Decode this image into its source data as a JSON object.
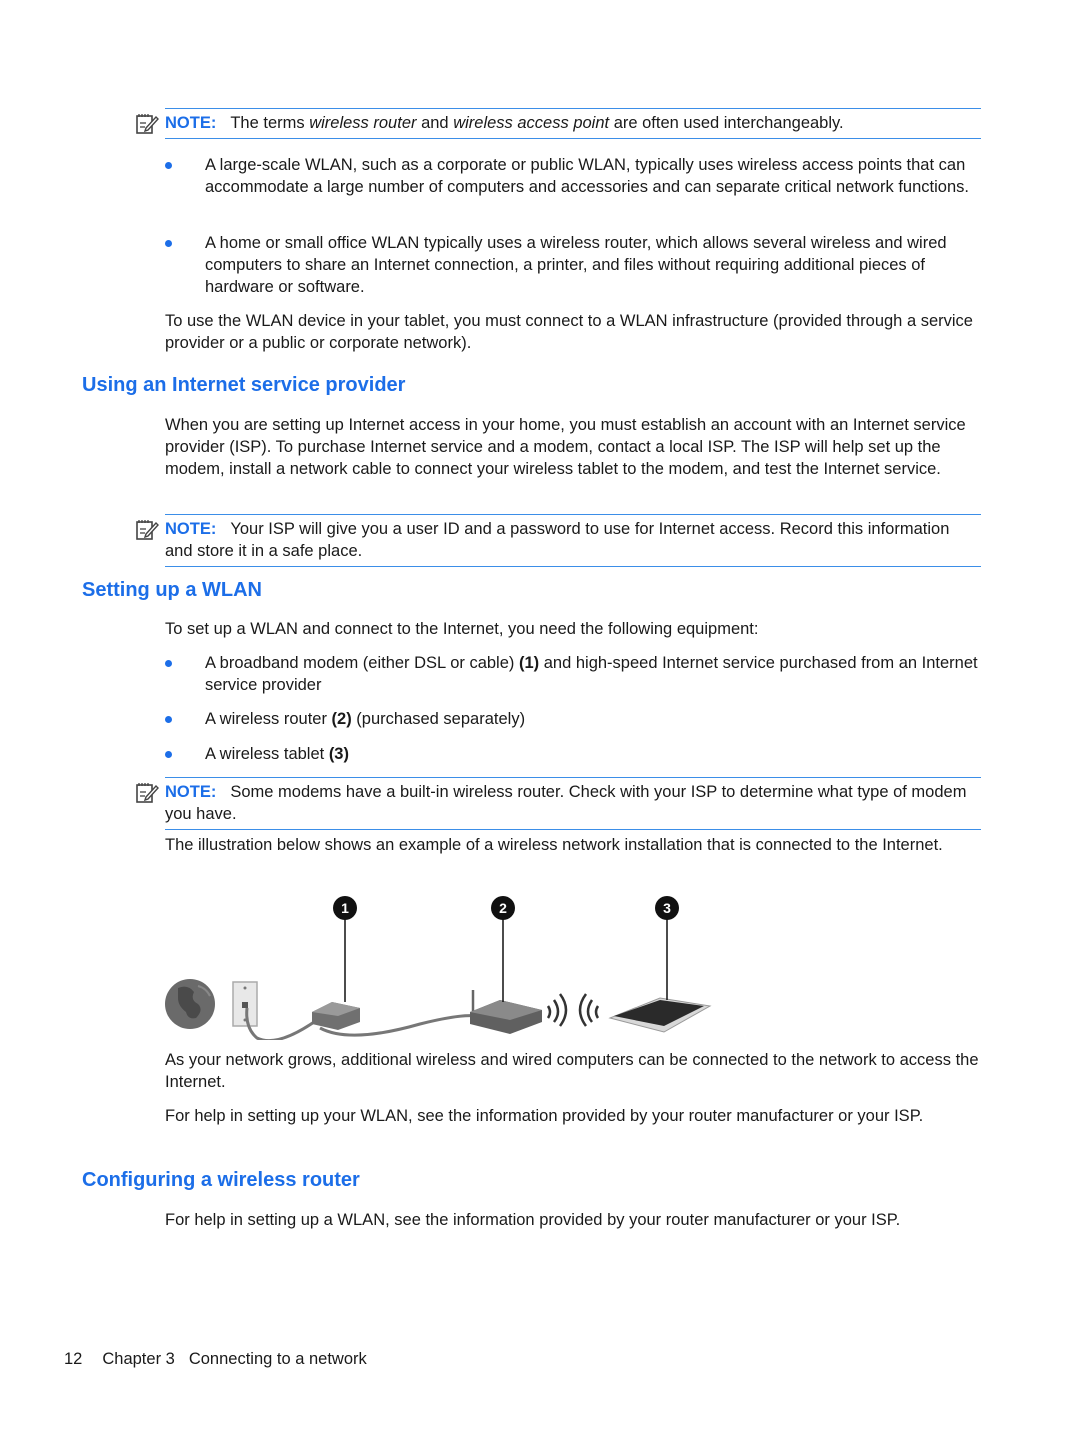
{
  "note1": {
    "label": "NOTE:",
    "text_parts": [
      "The terms ",
      "wireless router",
      " and ",
      "wireless access point",
      " are often used interchangeably."
    ]
  },
  "bullets1": [
    "A large-scale WLAN, such as a corporate or public WLAN, typically uses wireless access points that can accommodate a large number of computers and accessories and can separate critical network functions.",
    "A home or small office WLAN typically uses a wireless router, which allows several wireless and wired computers to share an Internet connection, a printer, and files without requiring additional pieces of hardware or software."
  ],
  "para1": "To use the WLAN device in your tablet, you must connect to a WLAN infrastructure (provided through a service provider or a public or corporate network).",
  "section_isp": {
    "heading": "Using an Internet service provider",
    "para": "When you are setting up Internet access in your home, you must establish an account with an Internet service provider (ISP). To purchase Internet service and a modem, contact a local ISP. The ISP will help set up the modem, install a network cable to connect your wireless tablet to the modem, and test the Internet service.",
    "note_label": "NOTE:",
    "note_text": "Your ISP will give you a user ID and a password to use for Internet access. Record this information and store it in a safe place."
  },
  "section_wlan": {
    "heading": "Setting up a WLAN",
    "intro": "To set up a WLAN and connect to the Internet, you need the following equipment:",
    "items": [
      {
        "pre": "A broadband modem (either DSL or cable) ",
        "num": "(1)",
        "post": " and high-speed Internet service purchased from an Internet service provider"
      },
      {
        "pre": "A wireless router ",
        "num": "(2)",
        "post": " (purchased separately)"
      },
      {
        "pre": "A wireless tablet ",
        "num": "(3)",
        "post": ""
      }
    ],
    "note_label": "NOTE:",
    "note_text": "Some modems have a built-in wireless router. Check with your ISP to determine what type of modem you have.",
    "illustration_intro": "The illustration below shows an example of a wireless network installation that is connected to the Internet.",
    "callouts": [
      "1",
      "2",
      "3"
    ],
    "para_after1": "As your network grows, additional wireless and wired computers can be connected to the network to access the Internet.",
    "para_after2": "For help in setting up your WLAN, see the information provided by your router manufacturer or your ISP."
  },
  "section_router": {
    "heading": "Configuring a wireless router",
    "para": "For help in setting up a WLAN, see the information provided by your router manufacturer or your ISP."
  },
  "footer": {
    "page_number": "12",
    "chapter": "Chapter 3",
    "title": "Connecting to a network"
  }
}
